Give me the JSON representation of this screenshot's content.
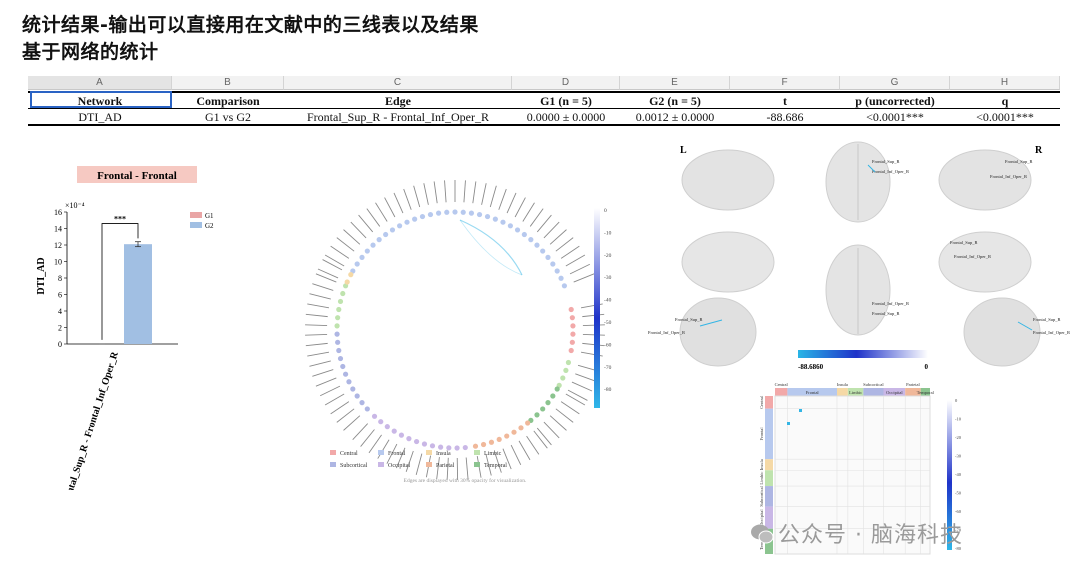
{
  "heading": {
    "line1": "统计结果-输出可以直接用在文献中的三线表以及结果",
    "line2": "基于网络的统计"
  },
  "spreadsheet": {
    "column_letters": [
      "A",
      "B",
      "C",
      "D",
      "E",
      "F",
      "G",
      "H"
    ],
    "headers": [
      "Network",
      "Comparison",
      "Edge",
      "G1 (n = 5)",
      "G2 (n = 5)",
      "t",
      "p (uncorrected)",
      "q"
    ],
    "rows": [
      [
        "DTI_AD",
        "G1 vs G2",
        "Frontal_Sup_R - Frontal_Inf_Oper_R",
        "0.0000 ± 0.0000",
        "0.0012 ± 0.0000",
        "-88.686",
        "<0.0001***",
        "<0.0001***"
      ]
    ]
  },
  "chart_data": [
    {
      "type": "bar",
      "title": "Frontal - Frontal",
      "categories": [
        "Frontal_Sup_R - Frontal_Inf_Oper_R"
      ],
      "series": [
        {
          "name": "G1",
          "values": [
            0.0
          ],
          "error": [
            0.0
          ],
          "color": "#e9a5a5"
        },
        {
          "name": "G2",
          "values": [
            12.1
          ],
          "error": [
            0.3
          ],
          "color": "#a1bfe3"
        }
      ],
      "ylabel": "DTI_AD",
      "y_multiplier": "×10⁻⁴",
      "yticks": [
        0,
        2,
        4,
        6,
        8,
        10,
        12,
        14,
        16
      ],
      "ylim": [
        0,
        16
      ],
      "significance": "***",
      "legend": "top-right"
    },
    {
      "type": "circular-connectivity",
      "colorbar_ticks": [
        "0",
        "-10",
        "-20",
        "-30",
        "-40",
        "-50",
        "-60",
        "-70",
        "-80"
      ],
      "legend": [
        {
          "name": "Central",
          "color": "#f2a9a9"
        },
        {
          "name": "Frontal",
          "color": "#b7c9ee"
        },
        {
          "name": "Insula",
          "color": "#f5d9a6"
        },
        {
          "name": "Limbic",
          "color": "#bfe3ae"
        },
        {
          "name": "Subcortical",
          "color": "#aeb6e3"
        },
        {
          "name": "Occipital",
          "color": "#c9b7e6"
        },
        {
          "name": "Parietal",
          "color": "#f0b89a"
        },
        {
          "name": "Temporal",
          "color": "#8bc48f"
        }
      ],
      "caption": "Edges are displayed with 30% opacity for visualization."
    },
    {
      "type": "brain-views",
      "side_labels": [
        "L",
        "R"
      ],
      "node_labels": [
        "Frontal_Sup_R",
        "Frontal_Inf_Oper_R"
      ],
      "colorbar_min": "-88.6860",
      "colorbar_max": "0"
    },
    {
      "type": "heatmap",
      "top_groups": [
        "Central",
        "Frontal",
        "Insula",
        "Limbic",
        "Subcortical",
        "Occipital",
        "Parietal",
        "Temporal"
      ],
      "left_groups": [
        "Central",
        "Frontal",
        "Insula",
        "Limbic",
        "Subcortical",
        "Occipital",
        "Temporal"
      ],
      "colorbar_ticks": [
        "0",
        "-10",
        "-20",
        "-30",
        "-40",
        "-50",
        "-60",
        "-70",
        "-80"
      ]
    }
  ],
  "watermark": "公众号 · 脑海科技"
}
